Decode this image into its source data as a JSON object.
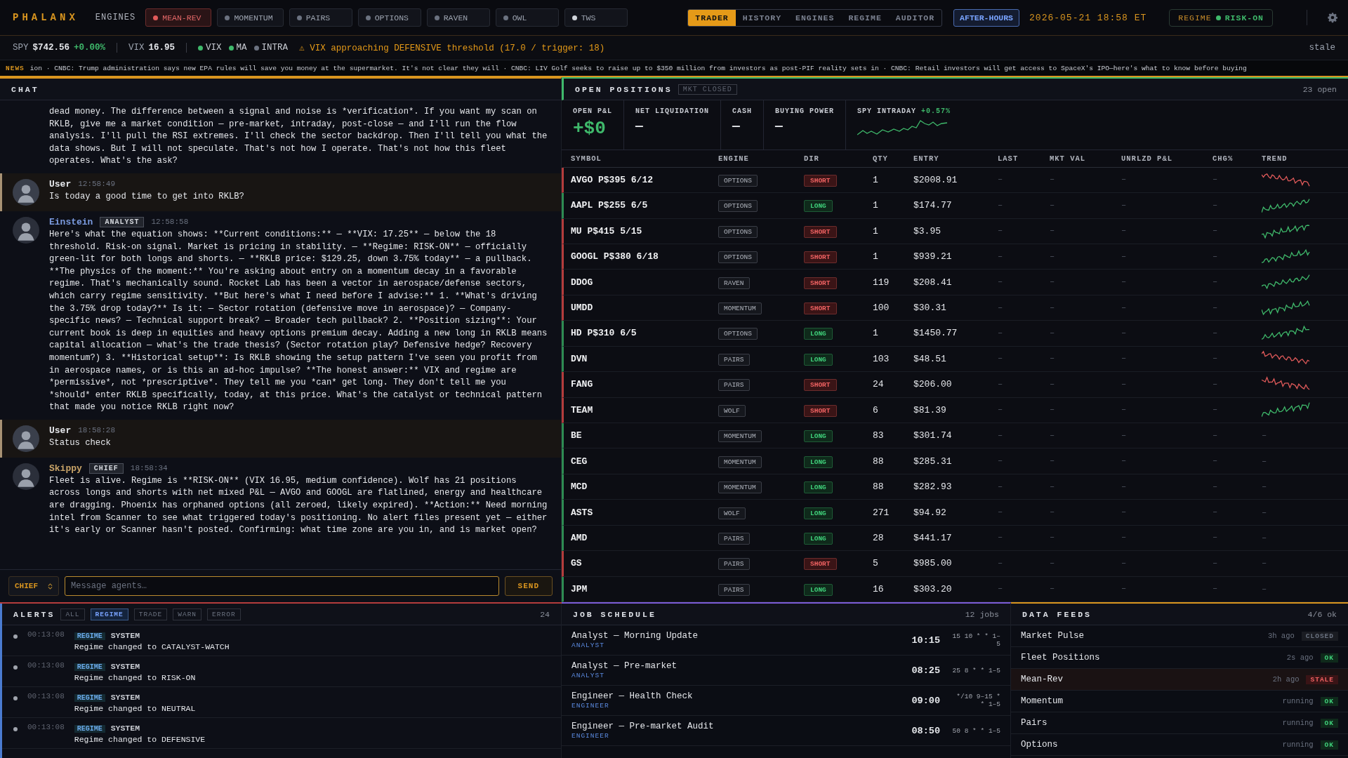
{
  "brand": "PHALANX",
  "engines_label": "ENGINES",
  "engines": [
    {
      "label": "MEAN-REV",
      "selected": true,
      "color": "#e05a5a"
    },
    {
      "label": "MOMENTUM",
      "selected": false,
      "color": "#6b7280"
    },
    {
      "label": "PAIRS",
      "selected": false,
      "color": "#6b7280"
    },
    {
      "label": "OPTIONS",
      "selected": false,
      "color": "#6b7280"
    },
    {
      "label": "RAVEN",
      "selected": false,
      "color": "#6b7280"
    },
    {
      "label": "OWL",
      "selected": false,
      "color": "#6b7280"
    },
    {
      "label": "TWS",
      "selected": false,
      "color": "#d1d5db"
    }
  ],
  "nav_tabs": [
    {
      "label": "TRADER",
      "selected": true
    },
    {
      "label": "HISTORY",
      "selected": false
    },
    {
      "label": "ENGINES",
      "selected": false
    },
    {
      "label": "REGIME",
      "selected": false
    },
    {
      "label": "AUDITOR",
      "selected": false
    }
  ],
  "session": "AFTER-HOURS",
  "clock": "2026-05-21 18:58 ET",
  "regime": {
    "label": "REGIME",
    "value": "RISK-ON"
  },
  "ticker": {
    "spy_label": "SPY",
    "spy_price": "$742.56",
    "spy_change": "+0.00%",
    "vix_label": "VIX",
    "vix_value": "16.95",
    "indicators": [
      {
        "label": "VIX",
        "color": "#3fb96b"
      },
      {
        "label": "MA",
        "color": "#3fb96b"
      },
      {
        "label": "INTRA",
        "color": "#6b7280"
      }
    ],
    "warning": "⚠ VIX approaching DEFENSIVE threshold (17.0 / trigger: 18)",
    "status": "stale"
  },
  "news": {
    "label": "NEWS",
    "text": "ion · CNBC: Trump administration says new EPA rules will save you money at the supermarket. It's not clear they will · CNBC: LIV Golf seeks to raise up to $350 million from investors as post-PIF reality sets in · CNBC: Retail investors will get access to SpaceX's IPO—here's what to know before buying"
  },
  "chat": {
    "title": "CHAT",
    "messages": [
      {
        "kind": "agent",
        "continued": true,
        "text": "dead money. The difference between a signal and noise is *verification*. If you want my scan on RKLB, give me a market condition — pre-market, intraday, post-close — and I'll run the flow analysis. I'll pull the RSI extremes. I'll check the sector backdrop. Then I'll tell you what the data shows. But I will not speculate. That's not how I operate. That's not how this fleet operates. What's the ask?"
      },
      {
        "kind": "user",
        "sender": "User",
        "time": "12:58:49",
        "color": "#e5e7eb",
        "text": "Is today a good time to get into RKLB?"
      },
      {
        "kind": "agent",
        "sender": "Einstein",
        "role": "ANALYST",
        "time": "12:58:58",
        "color": "#7b9be0",
        "text": "Here's what the equation shows: **Current conditions:** — **VIX: 17.25** — below the 18 threshold. Risk-on signal. Market is pricing in stability. — **Regime: RISK-ON** — officially green-lit for both longs and shorts. — **RKLB price: $129.25, down 3.75% today** — a pullback. **The physics of the moment:** You're asking about entry on a momentum decay in a favorable regime. That's mechanically sound. Rocket Lab has been a vector in aerospace/defense sectors, which carry regime sensitivity. **But here's what I need before I advise:** 1. **What's driving the 3.75% drop today?** Is it: — Sector rotation (defensive move in aerospace)? — Company-specific news? — Technical support break? — Broader tech pullback? 2. **Position sizing**: Your current book is deep in equities and heavy options premium decay. Adding a new long in RKLB means capital allocation — what's the trade thesis? (Sector rotation play? Defensive hedge? Recovery momentum?) 3. **Historical setup**: Is RKLB showing the setup pattern I've seen you profit from in aerospace names, or is this an ad-hoc impulse? **The honest answer:** VIX and regime are *permissive*, not *prescriptive*. They tell me you *can* get long. They don't tell me you *should* enter RKLB specifically, today, at this price. What's the catalyst or technical pattern that made you notice RKLB right now?"
      },
      {
        "kind": "user",
        "sender": "User",
        "time": "18:58:28",
        "color": "#e5e7eb",
        "text": "Status check"
      },
      {
        "kind": "agent",
        "sender": "Skippy",
        "role": "CHIEF",
        "time": "18:58:34",
        "color": "#c9a468",
        "text": "Fleet is alive. Regime is **RISK-ON** (VIX 16.95, medium confidence). Wolf has 21 positions across longs and shorts with net mixed P&L — AVGO and GOOGL are flatlined, energy and healthcare are dragging. Phoenix has orphaned options (all zeroed, likely expired). **Action:** Need morning intel from Scanner to see what triggered today's positioning. No alert files present yet — either it's early or Scanner hasn't posted. Confirming: what time zone are you in, and is market open?"
      }
    ],
    "target": "CHIEF",
    "placeholder": "Message agents…",
    "send": "SEND"
  },
  "positions": {
    "title": "OPEN POSITIONS",
    "market": "MKT CLOSED",
    "count": "23 open",
    "summary": [
      {
        "label": "OPEN P&L",
        "value": "+$0",
        "kind": "big"
      },
      {
        "label": "NET LIQUIDATION",
        "value": "—",
        "kind": "plain"
      },
      {
        "label": "CASH",
        "value": "—",
        "kind": "plain"
      },
      {
        "label": "BUYING POWER",
        "value": "—",
        "kind": "plain"
      }
    ],
    "spy_label": "SPY INTRADAY",
    "spy_change": "+0.57%",
    "columns": [
      "SYMBOL",
      "ENGINE",
      "DIR",
      "QTY",
      "ENTRY",
      "LAST",
      "MKT VAL",
      "UNRLZD P&L",
      "CHG%",
      "TREND"
    ],
    "rows": [
      {
        "symbol": "AVGO P$395 6/12",
        "engine": "OPTIONS",
        "dir": "SHORT",
        "kind": "short",
        "qty": "1",
        "entry": "$2008.91",
        "last": "–",
        "mkt_val": "–",
        "pnl": "–",
        "chg": "–",
        "trend_rising": false
      },
      {
        "symbol": "AAPL P$255 6/5",
        "engine": "OPTIONS",
        "dir": "LONG",
        "kind": "long",
        "qty": "1",
        "entry": "$174.77",
        "last": "–",
        "mkt_val": "–",
        "pnl": "–",
        "chg": "–",
        "trend_rising": true
      },
      {
        "symbol": "MU P$415 5/15",
        "engine": "OPTIONS",
        "dir": "SHORT",
        "kind": "short",
        "qty": "1",
        "entry": "$3.95",
        "last": "–",
        "mkt_val": "–",
        "pnl": "–",
        "chg": "–",
        "trend_rising": true
      },
      {
        "symbol": "GOOGL P$380 6/18",
        "engine": "OPTIONS",
        "dir": "SHORT",
        "kind": "short",
        "qty": "1",
        "entry": "$939.21",
        "last": "–",
        "mkt_val": "–",
        "pnl": "–",
        "chg": "–",
        "trend_rising": true
      },
      {
        "symbol": "DDOG",
        "engine": "RAVEN",
        "dir": "SHORT",
        "kind": "short",
        "qty": "119",
        "entry": "$208.41",
        "last": "–",
        "mkt_val": "–",
        "pnl": "–",
        "chg": "–",
        "trend_rising": true
      },
      {
        "symbol": "UMDD",
        "engine": "MOMENTUM",
        "dir": "SHORT",
        "kind": "short",
        "qty": "100",
        "entry": "$30.31",
        "last": "–",
        "mkt_val": "–",
        "pnl": "–",
        "chg": "–",
        "trend_rising": true
      },
      {
        "symbol": "HD P$310 6/5",
        "engine": "OPTIONS",
        "dir": "LONG",
        "kind": "long",
        "qty": "1",
        "entry": "$1450.77",
        "last": "–",
        "mkt_val": "–",
        "pnl": "–",
        "chg": "–",
        "trend_rising": true
      },
      {
        "symbol": "DVN",
        "engine": "PAIRS",
        "dir": "LONG",
        "kind": "long",
        "qty": "103",
        "entry": "$48.51",
        "last": "–",
        "mkt_val": "–",
        "pnl": "–",
        "chg": "–",
        "trend_rising": false
      },
      {
        "symbol": "FANG",
        "engine": "PAIRS",
        "dir": "SHORT",
        "kind": "short",
        "qty": "24",
        "entry": "$206.00",
        "last": "–",
        "mkt_val": "–",
        "pnl": "–",
        "chg": "–",
        "trend_rising": false
      },
      {
        "symbol": "TEAM",
        "engine": "WOLF",
        "dir": "SHORT",
        "kind": "short",
        "qty": "6",
        "entry": "$81.39",
        "last": "–",
        "mkt_val": "–",
        "pnl": "–",
        "chg": "–",
        "trend_rising": true
      },
      {
        "symbol": "BE",
        "engine": "MOMENTUM",
        "dir": "LONG",
        "kind": "long",
        "qty": "83",
        "entry": "$301.74",
        "last": "–",
        "mkt_val": "–",
        "pnl": "–",
        "chg": "–",
        "trend_text": "–"
      },
      {
        "symbol": "CEG",
        "engine": "MOMENTUM",
        "dir": "LONG",
        "kind": "long",
        "qty": "88",
        "entry": "$285.31",
        "last": "–",
        "mkt_val": "–",
        "pnl": "–",
        "chg": "–",
        "trend_text": "–"
      },
      {
        "symbol": "MCD",
        "engine": "MOMENTUM",
        "dir": "LONG",
        "kind": "long",
        "qty": "88",
        "entry": "$282.93",
        "last": "–",
        "mkt_val": "–",
        "pnl": "–",
        "chg": "–",
        "trend_text": "–"
      },
      {
        "symbol": "ASTS",
        "engine": "WOLF",
        "dir": "LONG",
        "kind": "long",
        "qty": "271",
        "entry": "$94.92",
        "last": "–",
        "mkt_val": "–",
        "pnl": "–",
        "chg": "–",
        "trend_text": "–"
      },
      {
        "symbol": "AMD",
        "engine": "PAIRS",
        "dir": "LONG",
        "kind": "long",
        "qty": "28",
        "entry": "$441.17",
        "last": "–",
        "mkt_val": "–",
        "pnl": "–",
        "chg": "–",
        "trend_text": "–"
      },
      {
        "symbol": "GS",
        "engine": "PAIRS",
        "dir": "SHORT",
        "kind": "short",
        "qty": "5",
        "entry": "$985.00",
        "last": "–",
        "mkt_val": "–",
        "pnl": "–",
        "chg": "–",
        "trend_text": "–"
      },
      {
        "symbol": "JPM",
        "engine": "PAIRS",
        "dir": "LONG",
        "kind": "long",
        "qty": "16",
        "entry": "$303.20",
        "last": "–",
        "mkt_val": "–",
        "pnl": "–",
        "chg": "–",
        "trend_text": "–"
      }
    ]
  },
  "alerts": {
    "title": "ALERTS",
    "filters": [
      {
        "label": "ALL",
        "selected": false
      },
      {
        "label": "REGIME",
        "selected": true
      },
      {
        "label": "TRADE",
        "selected": false
      },
      {
        "label": "WARN",
        "selected": false
      },
      {
        "label": "ERROR",
        "selected": false
      }
    ],
    "count": "24",
    "items": [
      {
        "time": "00:13:08",
        "tag": "REGIME",
        "source": "SYSTEM",
        "message": "Regime changed to CATALYST-WATCH"
      },
      {
        "time": "00:13:08",
        "tag": "REGIME",
        "source": "SYSTEM",
        "message": "Regime changed to RISK-ON"
      },
      {
        "time": "00:13:08",
        "tag": "REGIME",
        "source": "SYSTEM",
        "message": "Regime changed to NEUTRAL"
      },
      {
        "time": "00:13:08",
        "tag": "REGIME",
        "source": "SYSTEM",
        "message": "Regime changed to DEFENSIVE"
      }
    ]
  },
  "jobs": {
    "title": "JOB SCHEDULE",
    "count": "12 jobs",
    "items": [
      {
        "name": "Analyst — Morning Update",
        "role": "ANALYST",
        "time": "10:15",
        "cron": "15 10 * * 1–5"
      },
      {
        "name": "Analyst — Pre-market",
        "role": "ANALYST",
        "time": "08:25",
        "cron": "25 8 * * 1–5"
      },
      {
        "name": "Engineer — Health Check",
        "role": "ENGINEER",
        "time": "09:00",
        "cron": "*/10 9–15 * * 1–5"
      },
      {
        "name": "Engineer — Pre-market Audit",
        "role": "ENGINEER",
        "time": "08:50",
        "cron": "50 8 * * 1–5"
      }
    ]
  },
  "feeds": {
    "title": "DATA FEEDS",
    "count": "4/6 ok",
    "items": [
      {
        "name": "Market Pulse",
        "age": "3h ago",
        "status": "CLOSED",
        "kind": "closed"
      },
      {
        "name": "Fleet Positions",
        "age": "2s ago",
        "status": "OK",
        "kind": "ok"
      },
      {
        "name": "Mean-Rev",
        "age": "2h ago",
        "status": "STALE",
        "kind": "stale"
      },
      {
        "name": "Momentum",
        "age": "running",
        "status": "OK",
        "kind": "ok"
      },
      {
        "name": "Pairs",
        "age": "running",
        "status": "OK",
        "kind": "ok"
      },
      {
        "name": "Options",
        "age": "running",
        "status": "OK",
        "kind": "ok"
      }
    ]
  }
}
